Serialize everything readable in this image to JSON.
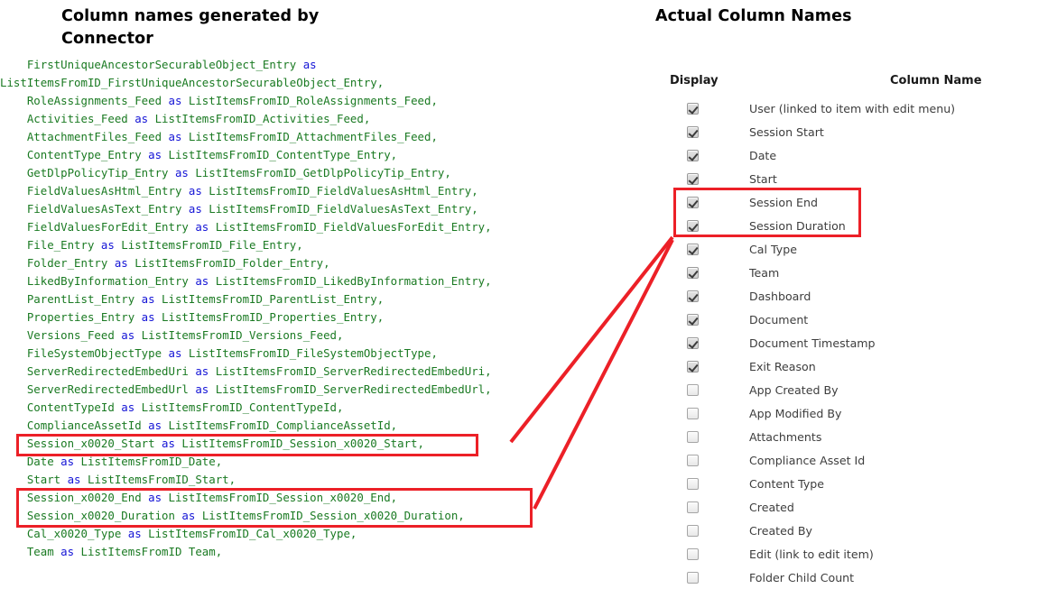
{
  "left_panel": {
    "title": "Column names generated by\nConnector",
    "code_lines": [
      {
        "indent": 4,
        "name": "FirstUniqueAncestorSecurableObject_Entry",
        "kw": " as",
        "alias": ""
      },
      {
        "indent": 0,
        "name": "ListItemsFromID_FirstUniqueAncestorSecurableObject_Entry,",
        "kw": "",
        "alias": ""
      },
      {
        "indent": 4,
        "name": "RoleAssignments_Feed",
        "kw": " as ",
        "alias": "ListItemsFromID_RoleAssignments_Feed,"
      },
      {
        "indent": 4,
        "name": "Activities_Feed",
        "kw": " as ",
        "alias": "ListItemsFromID_Activities_Feed,"
      },
      {
        "indent": 4,
        "name": "AttachmentFiles_Feed",
        "kw": " as ",
        "alias": "ListItemsFromID_AttachmentFiles_Feed,"
      },
      {
        "indent": 4,
        "name": "ContentType_Entry",
        "kw": " as ",
        "alias": "ListItemsFromID_ContentType_Entry,"
      },
      {
        "indent": 4,
        "name": "GetDlpPolicyTip_Entry",
        "kw": " as ",
        "alias": "ListItemsFromID_GetDlpPolicyTip_Entry,"
      },
      {
        "indent": 4,
        "name": "FieldValuesAsHtml_Entry",
        "kw": " as ",
        "alias": "ListItemsFromID_FieldValuesAsHtml_Entry,"
      },
      {
        "indent": 4,
        "name": "FieldValuesAsText_Entry",
        "kw": " as ",
        "alias": "ListItemsFromID_FieldValuesAsText_Entry,"
      },
      {
        "indent": 4,
        "name": "FieldValuesForEdit_Entry",
        "kw": " as ",
        "alias": "ListItemsFromID_FieldValuesForEdit_Entry,"
      },
      {
        "indent": 4,
        "name": "File_Entry",
        "kw": " as ",
        "alias": "ListItemsFromID_File_Entry,"
      },
      {
        "indent": 4,
        "name": "Folder_Entry",
        "kw": " as ",
        "alias": "ListItemsFromID_Folder_Entry,"
      },
      {
        "indent": 4,
        "name": "LikedByInformation_Entry",
        "kw": " as ",
        "alias": "ListItemsFromID_LikedByInformation_Entry,"
      },
      {
        "indent": 4,
        "name": "ParentList_Entry",
        "kw": " as ",
        "alias": "ListItemsFromID_ParentList_Entry,"
      },
      {
        "indent": 4,
        "name": "Properties_Entry",
        "kw": " as ",
        "alias": "ListItemsFromID_Properties_Entry,"
      },
      {
        "indent": 4,
        "name": "Versions_Feed",
        "kw": " as ",
        "alias": "ListItemsFromID_Versions_Feed,"
      },
      {
        "indent": 4,
        "name": "FileSystemObjectType",
        "kw": " as ",
        "alias": "ListItemsFromID_FileSystemObjectType,"
      },
      {
        "indent": 4,
        "name": "ServerRedirectedEmbedUri",
        "kw": " as ",
        "alias": "ListItemsFromID_ServerRedirectedEmbedUri,"
      },
      {
        "indent": 4,
        "name": "ServerRedirectedEmbedUrl",
        "kw": " as ",
        "alias": "ListItemsFromID_ServerRedirectedEmbedUrl,"
      },
      {
        "indent": 4,
        "name": "ContentTypeId",
        "kw": " as ",
        "alias": "ListItemsFromID_ContentTypeId,"
      },
      {
        "indent": 4,
        "name": "ComplianceAssetId",
        "kw": " as ",
        "alias": "ListItemsFromID_ComplianceAssetId,"
      },
      {
        "indent": 4,
        "name": "Session_x0020_Start",
        "kw": " as ",
        "alias": "ListItemsFromID_Session_x0020_Start,"
      },
      {
        "indent": 4,
        "name": "Date",
        "kw": " as ",
        "alias": "ListItemsFromID_Date,"
      },
      {
        "indent": 4,
        "name": "Start",
        "kw": " as ",
        "alias": "ListItemsFromID_Start,"
      },
      {
        "indent": 4,
        "name": "Session_x0020_End",
        "kw": " as ",
        "alias": "ListItemsFromID_Session_x0020_End,"
      },
      {
        "indent": 4,
        "name": "Session_x0020_Duration",
        "kw": " as ",
        "alias": "ListItemsFromID_Session_x0020_Duration,"
      },
      {
        "indent": 4,
        "name": "Cal_x0020_Type",
        "kw": " as ",
        "alias": "ListItemsFromID_Cal_x0020_Type,"
      },
      {
        "indent": 4,
        "name": "Team",
        "kw": " as ",
        "alias": "ListItemsFromID Team,"
      }
    ],
    "colors": {
      "identifier": "#1a7a22",
      "keyword": "#1414d6"
    }
  },
  "right_panel": {
    "title": "Actual Column Names",
    "headers": {
      "display": "Display",
      "column_name": "Column Name"
    },
    "rows": [
      {
        "label": "User (linked to item with edit menu)",
        "checked": true
      },
      {
        "label": "Session Start",
        "checked": true
      },
      {
        "label": "Date",
        "checked": true
      },
      {
        "label": "Start",
        "checked": true
      },
      {
        "label": "Session End",
        "checked": true
      },
      {
        "label": "Session Duration",
        "checked": true
      },
      {
        "label": "Cal Type",
        "checked": true
      },
      {
        "label": "Team",
        "checked": true
      },
      {
        "label": "Dashboard",
        "checked": true
      },
      {
        "label": "Document",
        "checked": true
      },
      {
        "label": "Document Timestamp",
        "checked": true
      },
      {
        "label": "Exit Reason",
        "checked": true
      },
      {
        "label": "App Created By",
        "checked": false
      },
      {
        "label": "App Modified By",
        "checked": false
      },
      {
        "label": "Attachments",
        "checked": false
      },
      {
        "label": "Compliance Asset Id",
        "checked": false
      },
      {
        "label": "Content Type",
        "checked": false
      },
      {
        "label": "Created",
        "checked": false
      },
      {
        "label": "Created By",
        "checked": false
      },
      {
        "label": "Edit (link to edit item)",
        "checked": false
      },
      {
        "label": "Folder Child Count",
        "checked": false
      }
    ]
  },
  "annotations": {
    "color": "#ec2027",
    "highlight_code_session_start": "Session_x0020_Start as ListItemsFromID_Session_x0020_Start,",
    "highlight_code_session_end_duration": "Session_x0020_End / Session_x0020_Duration",
    "highlight_rows": "Session End / Session Duration",
    "connector_lines": 2
  }
}
